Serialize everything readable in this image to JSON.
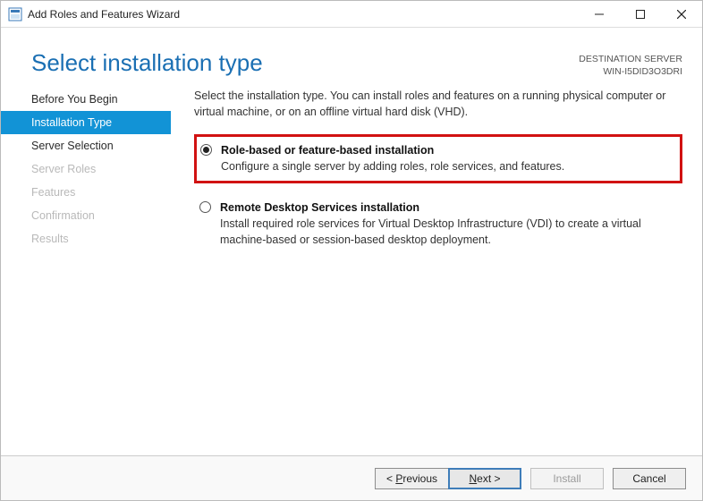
{
  "window": {
    "title": "Add Roles and Features Wizard"
  },
  "header": {
    "page_title": "Select installation type",
    "dest_label": "DESTINATION SERVER",
    "dest_value": "WIN-I5DID3O3DRI"
  },
  "sidebar": {
    "steps": [
      {
        "label": "Before You Begin",
        "state": "done"
      },
      {
        "label": "Installation Type",
        "state": "current"
      },
      {
        "label": "Server Selection",
        "state": "done"
      },
      {
        "label": "Server Roles",
        "state": "disabled"
      },
      {
        "label": "Features",
        "state": "disabled"
      },
      {
        "label": "Confirmation",
        "state": "disabled"
      },
      {
        "label": "Results",
        "state": "disabled"
      }
    ]
  },
  "main": {
    "intro": "Select the installation type. You can install roles and features on a running physical computer or virtual machine, or on an offline virtual hard disk (VHD).",
    "options": [
      {
        "title": "Role-based or feature-based installation",
        "desc": "Configure a single server by adding roles, role services, and features.",
        "selected": true,
        "highlight": true
      },
      {
        "title": "Remote Desktop Services installation",
        "desc": "Install required role services for Virtual Desktop Infrastructure (VDI) to create a virtual machine-based or session-based desktop deployment.",
        "selected": false,
        "highlight": false
      }
    ]
  },
  "footer": {
    "previous": "< Previous",
    "next": "Next >",
    "install": "Install",
    "cancel": "Cancel"
  }
}
